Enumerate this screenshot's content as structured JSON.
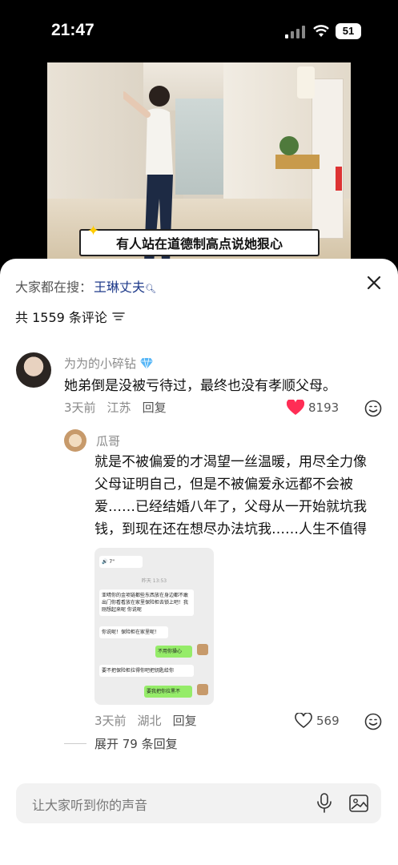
{
  "status_bar": {
    "time": "21:47",
    "battery": "51"
  },
  "video": {
    "caption": "有人站在道德制高点说她狠心"
  },
  "sheet": {
    "search_prefix": "大家都在搜：",
    "search_keyword": "王琳丈夫",
    "comment_count": "共 1559 条评论"
  },
  "comments": [
    {
      "author": "为为的小碎钻",
      "text": "她弟倒是没被亏待过，最终也没有孝顺父母。",
      "time": "3天前",
      "location": "江苏",
      "reply_label": "回复",
      "likes": "8193",
      "liked": true
    }
  ],
  "reply": {
    "author": "瓜哥",
    "text": "就是不被偏爱的才渴望一丝温暖，用尽全力像父母证明自己，但是不被偏爱永远都不会被爱……已经结婚八年了，父母从一开始就坑我钱，到现在还在想尽办法坑我……人生不值得",
    "time": "3天前",
    "location": "湖北",
    "reply_label": "回复",
    "likes": "569",
    "liked": false,
    "screenshot": {
      "voice": "7\"",
      "date": "昨天 13:53",
      "msg1": "亚晴你的金项链都些东西放在身边都不敢出门你看看放在家里保险柜去锁上吧！我刚想起来呢 你说呢",
      "msg2": "你说呢！保险柜在家里呢！",
      "msg3": "不用你操心",
      "msg4": "要不把保险柜拉得你吧把钥匙给你",
      "msg5": "要我把你拉黑不"
    }
  },
  "expand_label": "展开 79 条回复",
  "composer": {
    "placeholder": "让大家听到你的声音"
  },
  "colors": {
    "like_red": "#ff2d55",
    "keyword_blue": "#1e3a8a"
  }
}
